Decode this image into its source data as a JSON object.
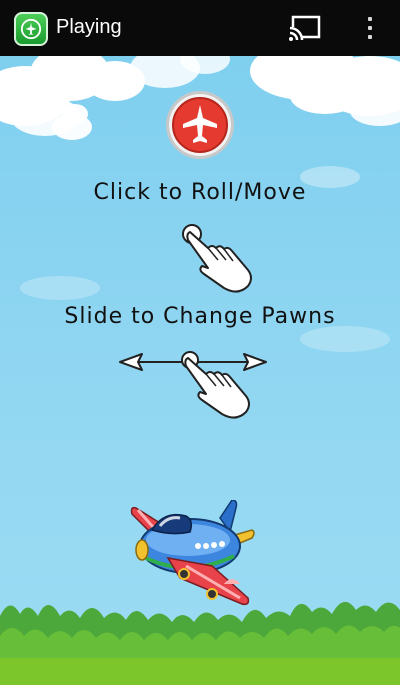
{
  "appbar": {
    "title": "Playing",
    "icon": "airplane-app-icon",
    "cast_icon": "cast-icon",
    "menu_icon": "overflow-menu-icon"
  },
  "tutorial": {
    "logo_icon": "airplane-badge-icon",
    "instruction_tap": "Click to Roll/Move",
    "instruction_slide": "Slide to Change Pawns",
    "tap_icon": "tap-hand-icon",
    "slide_icon": "swipe-hand-icon",
    "mascot": "cartoon-airplane"
  },
  "colors": {
    "sky": "#7fcfef",
    "appbar": "#0a0a0a",
    "badge_red": "#e53a2f",
    "grass": "#7cc52a"
  }
}
